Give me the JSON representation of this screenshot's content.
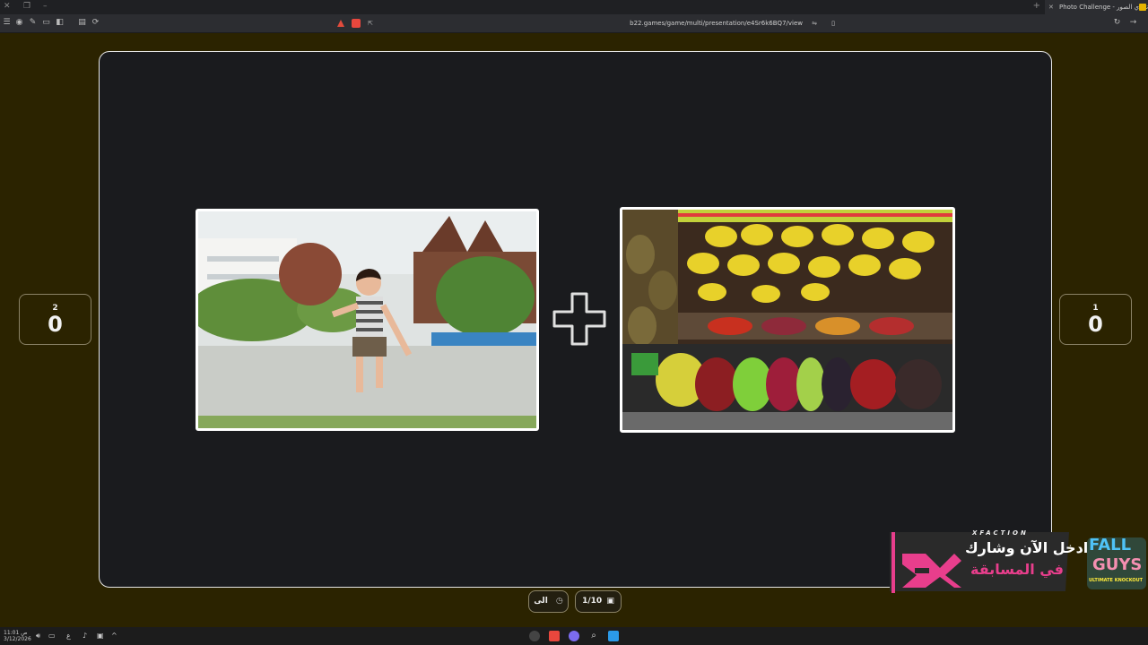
{
  "browser": {
    "tab_title": "Photo Challenge - تحدي الصور",
    "url": "b22.games/game/multi/presentation/e4Sr6k6BQ7/view"
  },
  "scores": {
    "left": {
      "player": "2",
      "score": "0"
    },
    "right": {
      "player": "1",
      "score": "0"
    }
  },
  "images": {
    "left": {
      "icon": "photo-boy-ball"
    },
    "right": {
      "icon": "photo-fruit-stand"
    }
  },
  "controls": {
    "timer_label": "الى",
    "progress": "1/10"
  },
  "taskbar": {
    "time": "ص 11:01",
    "date": "3/12/2026"
  },
  "ad": {
    "brand": "XFACTION",
    "line1": "ادخل الآن وشارك",
    "line2": "في المسابقة",
    "logo_top": "FALL",
    "logo_bottom": "GUYS",
    "logo_sub": "ULTIMATE KNOCKOUT"
  },
  "colors": {
    "background": "#2b2300",
    "panel": "#1a1b1e",
    "border": "#8a8266",
    "accent": "#e83e8c"
  }
}
